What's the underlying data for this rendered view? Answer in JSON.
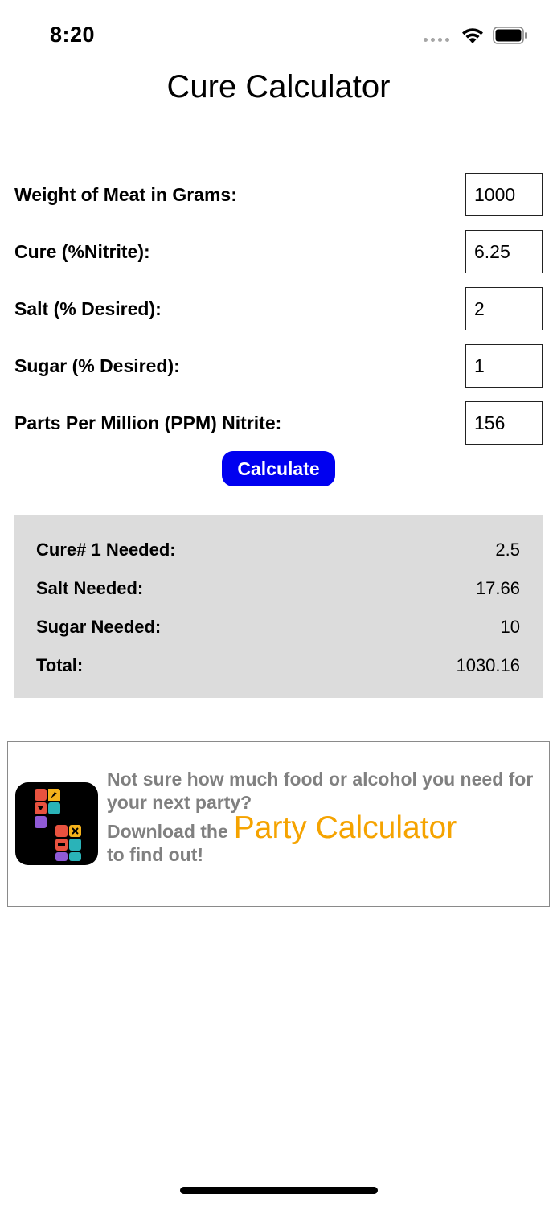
{
  "status_bar": {
    "time": "8:20"
  },
  "title": "Cure Calculator",
  "form": {
    "fields": [
      {
        "label": "Weight of Meat in Grams:",
        "value": "1000"
      },
      {
        "label": "Cure (%Nitrite):",
        "value": "6.25"
      },
      {
        "label": "Salt (% Desired):",
        "value": "2"
      },
      {
        "label": "Sugar (% Desired):",
        "value": "1"
      },
      {
        "label": "Parts Per Million (PPM) Nitrite:",
        "value": "156"
      }
    ],
    "calculate_label": "Calculate"
  },
  "results": [
    {
      "label": "Cure# 1 Needed:",
      "value": "2.5"
    },
    {
      "label": "Salt Needed:",
      "value": "17.66"
    },
    {
      "label": "Sugar Needed:",
      "value": "10"
    },
    {
      "label": "Total:",
      "value": "1030.16"
    }
  ],
  "ad": {
    "line1": "Not sure how much food or alcohol you need for your next party?",
    "line2_prefix": "Download the",
    "link_text": "Party Calculator",
    "line3": "to find out!"
  },
  "colors": {
    "accent": "#0000f0",
    "results_bg": "#dcdcdc",
    "ad_text": "#808080",
    "ad_link": "#f5a300"
  },
  "icons": [
    "cellular-signal-icon",
    "wifi-icon",
    "battery-icon",
    "party-calculator-app-icon"
  ]
}
